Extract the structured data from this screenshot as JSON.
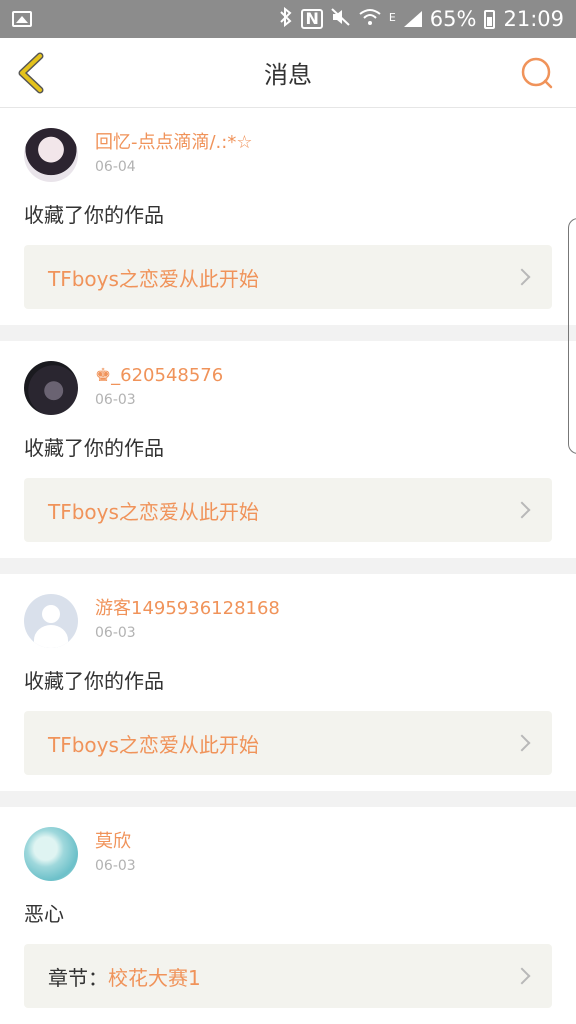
{
  "status_bar": {
    "battery": "65%",
    "time": "21:09",
    "network_label": "E",
    "icons": [
      "gallery-icon",
      "bluetooth-icon",
      "nfc-icon",
      "mute-icon",
      "wifi-icon",
      "signal-icon",
      "battery-icon"
    ]
  },
  "header": {
    "title": "消息",
    "back_icon": "chevron-left-icon",
    "search_icon": "search-icon",
    "accent": "#f0935a",
    "back_color": "#e4c21c"
  },
  "messages": [
    {
      "user": "回忆-点点滴滴/.:*☆",
      "date": "06-04",
      "action": "收藏了你的作品",
      "work_prefix": "",
      "work_title": "TFboys之恋爱从此开始"
    },
    {
      "user": "♚_620548576",
      "date": "06-03",
      "action": "收藏了你的作品",
      "work_prefix": "",
      "work_title": "TFboys之恋爱从此开始"
    },
    {
      "user": "游客1495936128168",
      "date": "06-03",
      "action": "收藏了你的作品",
      "work_prefix": "",
      "work_title": "TFboys之恋爱从此开始"
    },
    {
      "user": "莫欣",
      "date": "06-03",
      "action": "恶心",
      "work_prefix": "章节：",
      "work_title": "校花大赛1"
    }
  ]
}
